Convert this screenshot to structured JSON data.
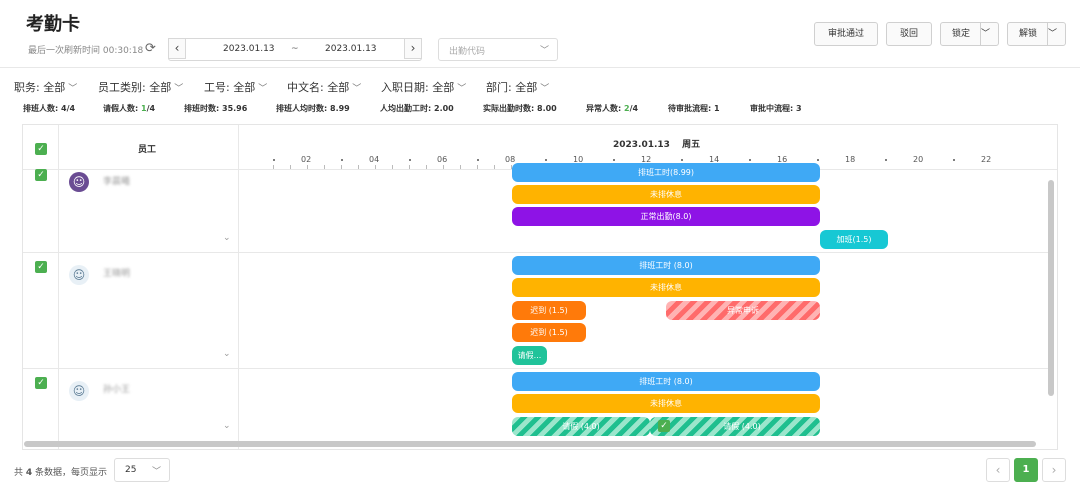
{
  "title": "考勤卡",
  "refresh_text": "最后一次刷新时间 00:30:18",
  "date_range": {
    "start": "2023.01.13",
    "separator": "~",
    "end": "2023.01.13",
    "prev": "‹",
    "next": "›"
  },
  "code_select": {
    "placeholder": "出勤代码"
  },
  "actions": {
    "approve": "审批通过",
    "reject": "驳回",
    "lock": "锁定",
    "unlock": "解锁"
  },
  "filters": [
    {
      "label": "职务:",
      "value": "全部"
    },
    {
      "label": "员工类别:",
      "value": "全部"
    },
    {
      "label": "工号:",
      "value": "全部"
    },
    {
      "label": "中文名:",
      "value": "全部"
    },
    {
      "label": "入职日期:",
      "value": "全部"
    },
    {
      "label": "部门:",
      "value": "全部"
    }
  ],
  "stats": {
    "scheduled_people": {
      "label": "排班人数:",
      "value": "4/4"
    },
    "leave_people": {
      "label": "请假人数:",
      "value_hl": "1",
      "value_rest": "/4"
    },
    "scheduled_hours": {
      "label": "排班时数:",
      "value": "35.96"
    },
    "avg_hours": {
      "label": "排班人均时数:",
      "value": "8.99"
    },
    "avg_attend": {
      "label": "人均出勤工时:",
      "value": "2.00"
    },
    "actual_hours": {
      "label": "实际出勤时数:",
      "value": "8.00"
    },
    "abnormal": {
      "label": "异常人数:",
      "value_hl": "2",
      "value_rest": "/4"
    },
    "pending": {
      "label": "待审批流程:",
      "value": "1"
    },
    "in_review": {
      "label": "审批中流程:",
      "value": "3"
    }
  },
  "grid": {
    "employee_header": "员工",
    "date_header": "2023.01.13　 周五",
    "ticks": [
      "02",
      "04",
      "06",
      "08",
      "10",
      "12",
      "14",
      "16",
      "18",
      "20",
      "22"
    ],
    "rows": [
      {
        "name": "李晨曦",
        "bars": [
          "排班工时(8.99)",
          "未排休息",
          "正常出勤(8.0)",
          "加班(1.5)"
        ]
      },
      {
        "name": "王晓明",
        "bars": [
          "排班工时 (8.0)",
          "未排休息",
          "迟到 (1.5)",
          "异常申诉",
          "迟到 (1.5)",
          "请假..."
        ]
      },
      {
        "name": "孙小王",
        "bars": [
          "排班工时 (8.0)",
          "未排休息",
          "请假 (4.0)",
          "请假 (4.0)"
        ]
      }
    ]
  },
  "footer": {
    "total_prefix": "共",
    "total": "4",
    "total_suffix": "条数据，每页显示",
    "page_size": "25",
    "current_page": "1"
  },
  "colors": {
    "accent": "#4caf50",
    "blue": "#3fa9f5",
    "orange": "#ffb300",
    "purple": "#8e13e6",
    "cyan": "#17c8d4",
    "late": "#ff7a0a",
    "leave": "#20c39a",
    "appeal": "#ff6b6b"
  }
}
